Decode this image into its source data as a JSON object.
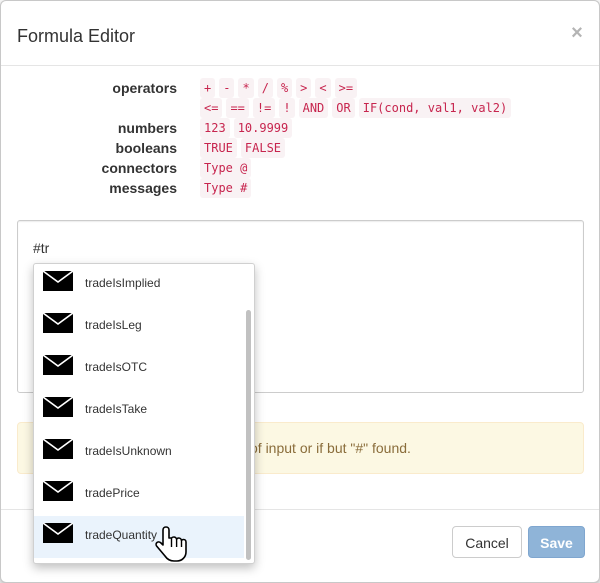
{
  "modal": {
    "title": "Formula Editor",
    "close_symbol": "×"
  },
  "legend": [
    {
      "label": "operators",
      "codes": [
        "+",
        "-",
        "*",
        "/",
        "%",
        ">",
        "<",
        ">="
      ]
    },
    {
      "label": "",
      "codes": [
        "<=",
        "==",
        "!=",
        "!",
        "AND",
        "OR",
        "IF(cond, val1, val2)"
      ]
    },
    {
      "label": "numbers",
      "codes": [
        "123",
        "10.9999"
      ]
    },
    {
      "label": "booleans",
      "codes": [
        "TRUE",
        "FALSE"
      ]
    },
    {
      "label": "connectors",
      "codes": [
        "Type @"
      ]
    },
    {
      "label": "messages",
      "codes": [
        "Type #"
      ]
    }
  ],
  "editor": {
    "value": "#tr"
  },
  "alert": {
    "text": "of input or if but \"#\" found."
  },
  "autocomplete": {
    "items": [
      {
        "label": "tradeIsImplied",
        "icon": "envelope-icon"
      },
      {
        "label": "tradeIsLeg",
        "icon": "envelope-icon"
      },
      {
        "label": "tradeIsOTC",
        "icon": "envelope-icon"
      },
      {
        "label": "tradeIsTake",
        "icon": "envelope-icon"
      },
      {
        "label": "tradeIsUnknown",
        "icon": "envelope-icon"
      },
      {
        "label": "tradePrice",
        "icon": "envelope-icon"
      },
      {
        "label": "tradeQuantity",
        "icon": "envelope-icon"
      }
    ],
    "active_index": 6
  },
  "footer": {
    "cancel_label": "Cancel",
    "save_label": "Save"
  },
  "colors": {
    "code_text": "#c7254e",
    "code_bg": "#f9f2f4",
    "alert_bg": "#fcf8e3",
    "alert_text": "#8a6d3b",
    "save_bg": "#8fb4d8"
  }
}
